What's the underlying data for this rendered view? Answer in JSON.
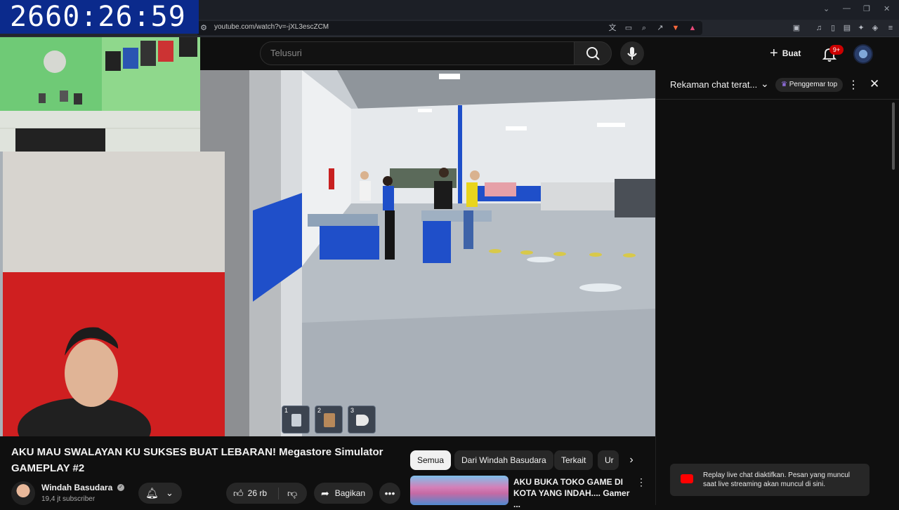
{
  "browser": {
    "url": "youtube.com/watch?v=-jXL3escZCM",
    "window_controls": [
      "⌄",
      "—",
      "❐",
      "✕"
    ]
  },
  "overlay": {
    "timer": "2660:26:59"
  },
  "header": {
    "search_placeholder": "Telusuri",
    "create_label": "Buat",
    "notification_count": "9+"
  },
  "video": {
    "title": "AKU MAU SWALAYAN KU SUKSES BUAT LEBARAN! Megastore Simulator GAMEPLAY #2",
    "hotbar": [
      "1",
      "2",
      "3"
    ]
  },
  "channel": {
    "name": "Windah Basudara",
    "subscribers": "19,4 jt subscriber"
  },
  "actions": {
    "likes": "26 rb",
    "share_label": "Bagikan"
  },
  "chips": [
    "Semua",
    "Dari Windah Basudara",
    "Terkait",
    "Ur"
  ],
  "recommended": {
    "title": "AKU BUKA TOKO GAME DI KOTA YANG INDAH.... Gamer ..."
  },
  "chat": {
    "title": "Rekaman chat terat...",
    "badge": "Penggemar top",
    "notice": "Replay live chat diaktifkan. Pesan yang muncul saat live streaming akan muncul di sini."
  },
  "colors": {
    "background": "#0f0f0f",
    "timer_bg": "#0b2a8c",
    "badge_red": "#cc0000",
    "store_blue": "#1f4fc9"
  }
}
